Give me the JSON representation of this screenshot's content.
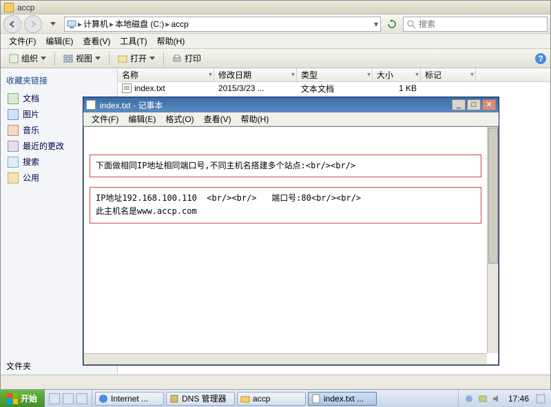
{
  "explorer": {
    "title": "accp",
    "breadcrumb": {
      "seg1": "计算机",
      "seg2": "本地磁盘 (C:)",
      "seg3": "accp"
    },
    "search": {
      "placeholder": "搜索"
    },
    "menu": {
      "file": "文件(F)",
      "edit": "编辑(E)",
      "view": "查看(V)",
      "tools": "工具(T)",
      "help": "帮助(H)"
    },
    "toolbar": {
      "organize": "组织",
      "views": "视图",
      "open": "打开",
      "print": "打印"
    },
    "sidebar": {
      "header": "收藏夹链接",
      "items": [
        {
          "label": "文档"
        },
        {
          "label": "图片"
        },
        {
          "label": "音乐"
        },
        {
          "label": "最近的更改"
        },
        {
          "label": "搜索"
        },
        {
          "label": "公用"
        }
      ],
      "footer": "文件夹"
    },
    "columns": {
      "name": "名称",
      "date": "修改日期",
      "type": "类型",
      "size": "大小",
      "tag": "标记"
    },
    "rows": [
      {
        "name": "index.txt",
        "date": "2015/3/23 ...",
        "type": "文本文档",
        "size": "1 KB",
        "tag": ""
      }
    ]
  },
  "notepad": {
    "title": "index.txt - 记事本",
    "menu": {
      "file": "文件(F)",
      "edit": "编辑(E)",
      "format": "格式(O)",
      "view": "查看(V)",
      "help": "帮助(H)"
    },
    "box1": "下面做相同IP地址相同端口号,不同主机名搭建多个站点:<br/><br/>",
    "box2": "IP地址192.168.100.110  <br/><br/>   端口号:80<br/><br/>\n此主机名是www.accp.com"
  },
  "taskbar": {
    "start": "开始",
    "items": [
      {
        "label": "Internet ..."
      },
      {
        "label": "DNS 管理器"
      },
      {
        "label": "accp"
      },
      {
        "label": "index.txt ..."
      }
    ],
    "clock": "17:46"
  }
}
